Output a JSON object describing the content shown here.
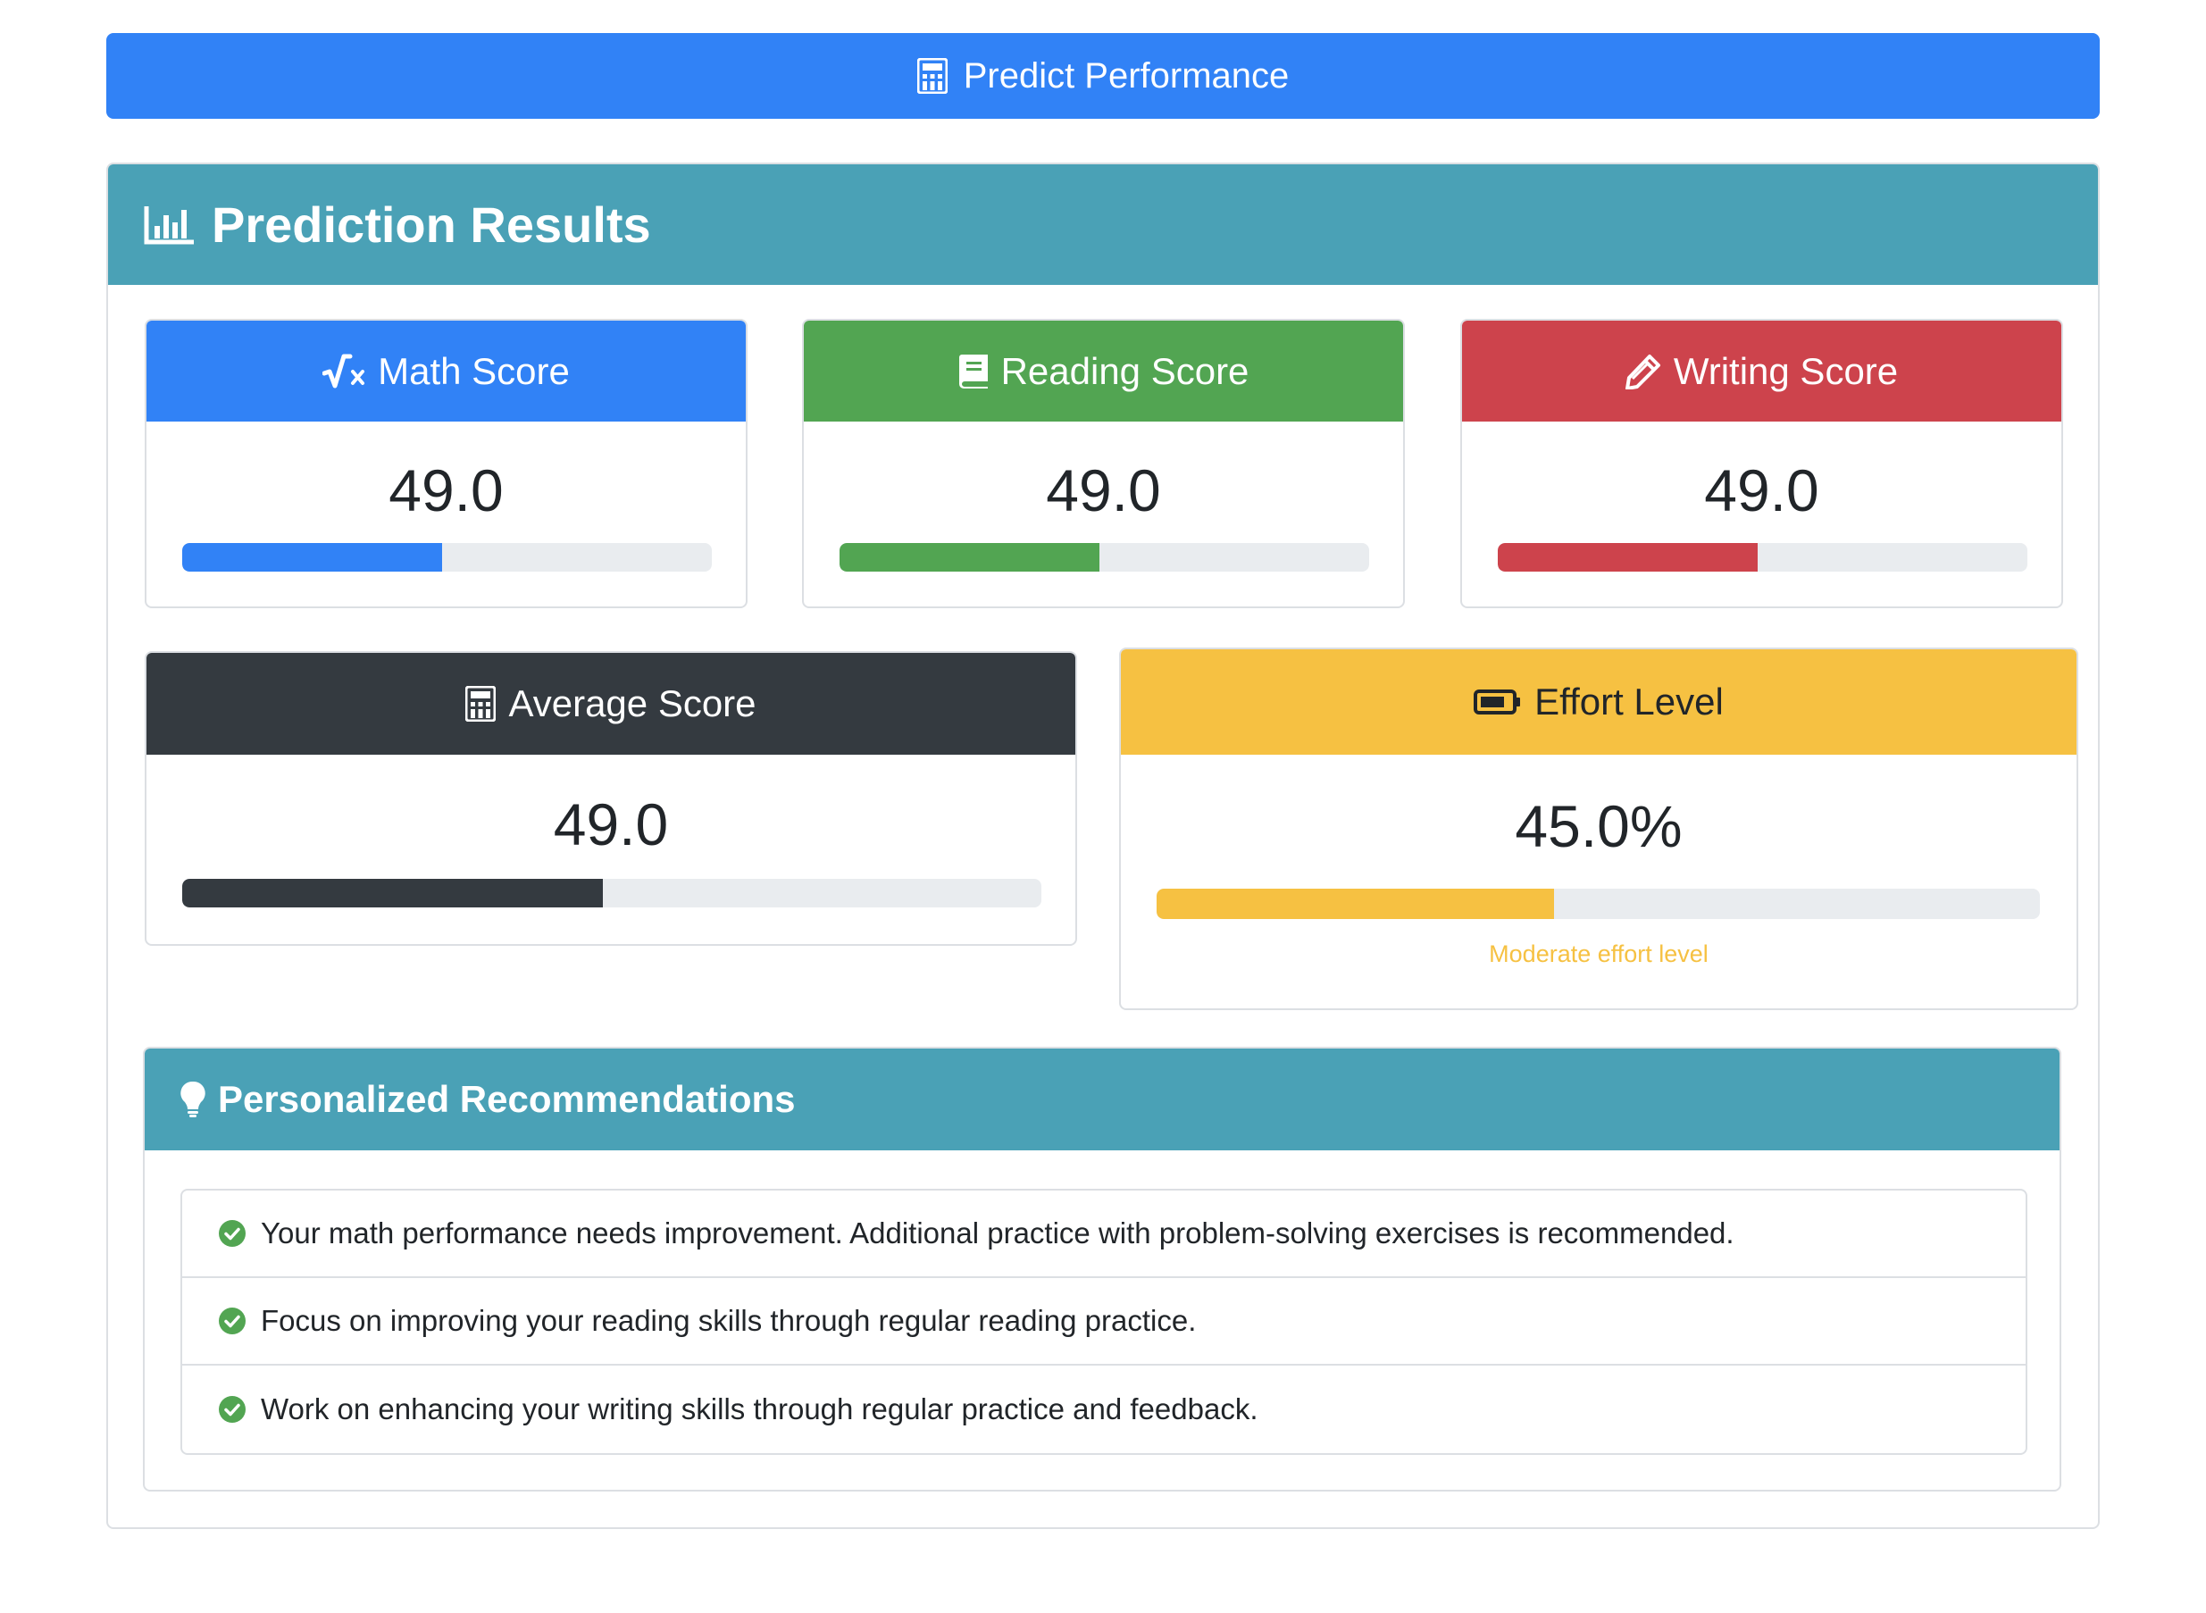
{
  "predict_button": {
    "label": "Predict Performance",
    "icon": "calculator-icon"
  },
  "results": {
    "title": "Prediction Results",
    "icon": "bar-chart-icon",
    "math": {
      "title": "Math Score",
      "icon": "square-root-icon",
      "value": "49.0",
      "progress_percent": 49,
      "color": "#3182f6"
    },
    "reading": {
      "title": "Reading Score",
      "icon": "book-icon",
      "value": "49.0",
      "progress_percent": 49,
      "color": "#52a552"
    },
    "writing": {
      "title": "Writing Score",
      "icon": "pencil-icon",
      "value": "49.0",
      "progress_percent": 49,
      "color": "#cd434c"
    },
    "average": {
      "title": "Average Score",
      "icon": "calculator-icon",
      "value": "49.0",
      "progress_percent": 49,
      "color": "#343a40"
    },
    "effort": {
      "title": "Effort Level",
      "icon": "battery-half-icon",
      "value": "45.0%",
      "progress_percent": 45,
      "note": "Moderate effort level",
      "color": "#f6c142"
    }
  },
  "recommendations": {
    "title": "Personalized Recommendations",
    "icon": "lightbulb-icon",
    "items": [
      "Your math performance needs improvement. Additional practice with problem-solving exercises is recommended.",
      "Focus on improving your reading skills through regular reading practice.",
      "Work on enhancing your writing skills through regular practice and feedback."
    ]
  },
  "colors": {
    "primary": "#3182f6",
    "info": "#4aa1b6",
    "success": "#52a552",
    "danger": "#cd434c",
    "dark": "#343a40",
    "warning": "#f6c142"
  }
}
